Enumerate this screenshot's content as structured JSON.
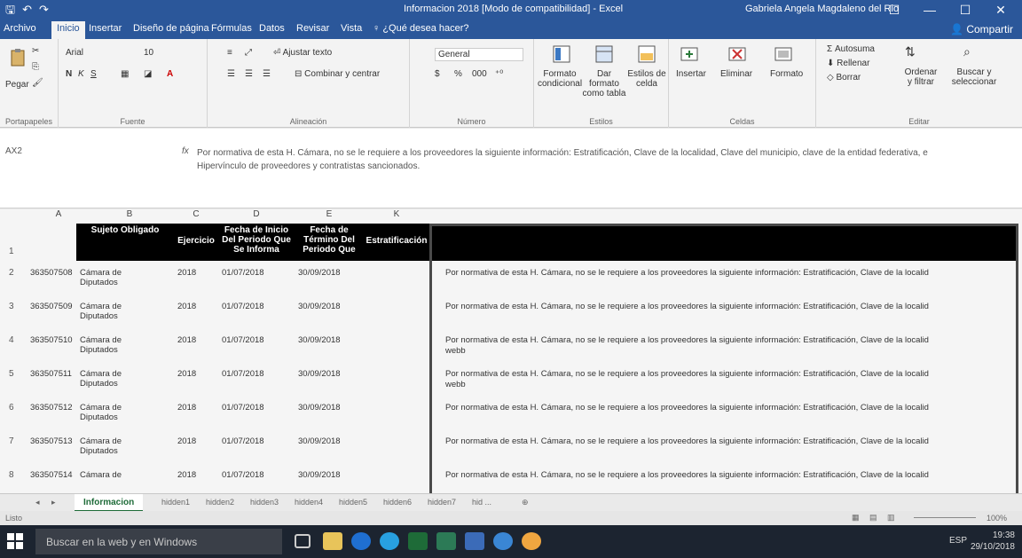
{
  "window": {
    "doc_title": "Informacion 2018 [Modo de compatibilidad] - Excel",
    "user": "Gabriela Angela Magdaleno del Rio",
    "min": "—",
    "max": "☐",
    "close": "✕"
  },
  "tabs": {
    "archivo": "Archivo",
    "inicio": "Inicio",
    "insertar": "Insertar",
    "diseno": "Diseño de página",
    "formulas": "Fórmulas",
    "datos": "Datos",
    "revisar": "Revisar",
    "vista": "Vista",
    "tell": "¿Qué desea hacer?",
    "share": "Compartir"
  },
  "ribbon": {
    "pegar": "Pegar",
    "portapapeles": "Portapapeles",
    "font_name": "Arial",
    "font_size": "10",
    "fuente": "Fuente",
    "ajustar": "Ajustar texto",
    "combinar": "Combinar y centrar",
    "alineacion": "Alineación",
    "number_format": "General",
    "numero": "Número",
    "formato_cond": "Formato condicional",
    "dar_formato": "Dar formato como tabla",
    "estilos_celda": "Estilos de celda",
    "estilos": "Estilos",
    "insertar": "Insertar",
    "eliminar": "Eliminar",
    "formato": "Formato",
    "celdas": "Celdas",
    "autosuma": "Autosuma",
    "rellenar": "Rellenar",
    "borrar": "Borrar",
    "ordenar": "Ordenar y filtrar",
    "buscar": "Buscar y seleccionar",
    "editar": "Editar"
  },
  "formula_bar": {
    "name_box": "AX2",
    "fx": "fx",
    "content": "Por normativa de esta H. Cámara, no se le requiere a los proveedores la siguiente información: Estratificación, Clave de la localidad, Clave del municipio, clave de la entidad federativa, e Hipervínculo de proveedores y contratistas sancionados."
  },
  "grid": {
    "columns": [
      "A",
      "B",
      "C",
      "D",
      "E",
      "K"
    ],
    "headers": {
      "sujeto": "Sujeto Obligado",
      "ejercicio": "Ejercicio",
      "inicio": "Fecha de Inicio Del Periodo Que Se Informa",
      "termino": "Fecha de Término Del Periodo Que",
      "estrat": "Estratificación"
    },
    "rows": [
      {
        "num": "2",
        "id": "363507508",
        "sujeto": "Cámara de Diputados",
        "ejercicio": "2018",
        "inicio": "01/07/2018",
        "termino": "30/09/2018",
        "nota": "Por normativa de esta H. Cámara, no se le requiere a los proveedores la siguiente información: Estratificación, Clave de la localid",
        "extra": ""
      },
      {
        "num": "3",
        "id": "363507509",
        "sujeto": "Cámara de Diputados",
        "ejercicio": "2018",
        "inicio": "01/07/2018",
        "termino": "30/09/2018",
        "nota": "Por normativa de esta H. Cámara, no se le requiere a los proveedores la siguiente información: Estratificación, Clave de la localid",
        "extra": ""
      },
      {
        "num": "4",
        "id": "363507510",
        "sujeto": "Cámara de Diputados",
        "ejercicio": "2018",
        "inicio": "01/07/2018",
        "termino": "30/09/2018",
        "nota": "Por normativa de esta H. Cámara, no se le requiere a los proveedores la siguiente información: Estratificación, Clave de la localid",
        "extra": "webb"
      },
      {
        "num": "5",
        "id": "363507511",
        "sujeto": "Cámara de Diputados",
        "ejercicio": "2018",
        "inicio": "01/07/2018",
        "termino": "30/09/2018",
        "nota": "Por normativa de esta H. Cámara, no se le requiere a los proveedores la siguiente información: Estratificación, Clave de la localid",
        "extra": "webb"
      },
      {
        "num": "6",
        "id": "363507512",
        "sujeto": "Cámara de Diputados",
        "ejercicio": "2018",
        "inicio": "01/07/2018",
        "termino": "30/09/2018",
        "nota": "Por normativa de esta H. Cámara, no se le requiere a los proveedores la siguiente información: Estratificación, Clave de la localid",
        "extra": ""
      },
      {
        "num": "7",
        "id": "363507513",
        "sujeto": "Cámara de Diputados",
        "ejercicio": "2018",
        "inicio": "01/07/2018",
        "termino": "30/09/2018",
        "nota": "Por normativa de esta H. Cámara, no se le requiere a los proveedores la siguiente información: Estratificación, Clave de la localid",
        "extra": ""
      },
      {
        "num": "8",
        "id": "363507514",
        "sujeto": "Cámara de",
        "ejercicio": "2018",
        "inicio": "01/07/2018",
        "termino": "30/09/2018",
        "nota": "Por normativa de esta H. Cámara, no se le requiere a los proveedores la siguiente información: Estratificación, Clave de la localid",
        "extra": ""
      }
    ]
  },
  "sheets": {
    "active": "Informacion",
    "others": [
      "hidden1",
      "hidden2",
      "hidden3",
      "hidden4",
      "hidden5",
      "hidden6",
      "hidden7",
      "hid ..."
    ]
  },
  "status": {
    "ready": "Listo",
    "zoom": "100%"
  },
  "taskbar": {
    "search": "Buscar en la web y en Windows",
    "lang": "ESP",
    "time": "19:38",
    "date": "29/10/2018"
  },
  "colors": {
    "excel_blue": "#2b579a",
    "excel_green": "#1e6b38",
    "header_black": "#000000"
  }
}
